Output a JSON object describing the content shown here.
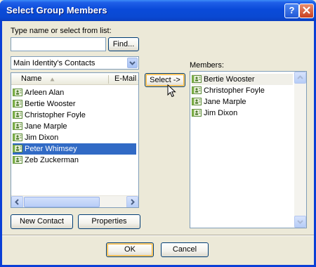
{
  "window": {
    "title": "Select Group Members",
    "help_glyph": "?"
  },
  "search": {
    "label": "Type name or select from list:",
    "value": "",
    "find_label": "Find..."
  },
  "source": {
    "selected": "Main Identity's Contacts"
  },
  "contacts_list": {
    "col_name": "Name",
    "col_email": "E-Mail A",
    "items": [
      {
        "name": "Arleen Alan",
        "selected": false
      },
      {
        "name": "Bertie Wooster",
        "selected": false
      },
      {
        "name": "Christopher Foyle",
        "selected": false
      },
      {
        "name": "Jane Marple",
        "selected": false
      },
      {
        "name": "Jim Dixon",
        "selected": false
      },
      {
        "name": "Peter Whimsey",
        "selected": true
      },
      {
        "name": "Zeb Zuckerman",
        "selected": false
      }
    ]
  },
  "select_button": {
    "label": "Select ->"
  },
  "members": {
    "label": "Members:",
    "items": [
      {
        "name": "Bertie Wooster"
      },
      {
        "name": "Christopher Foyle"
      },
      {
        "name": "Jane Marple"
      },
      {
        "name": "Jim Dixon"
      }
    ]
  },
  "buttons": {
    "new_contact": "New Contact",
    "properties": "Properties",
    "ok": "OK",
    "cancel": "Cancel"
  },
  "colors": {
    "title_bar": "#0a4ad9",
    "selection": "#316ac5",
    "face": "#ece9d8"
  },
  "icons": {
    "contact": "contact-card-icon",
    "cursor": "mouse-pointer-icon"
  }
}
